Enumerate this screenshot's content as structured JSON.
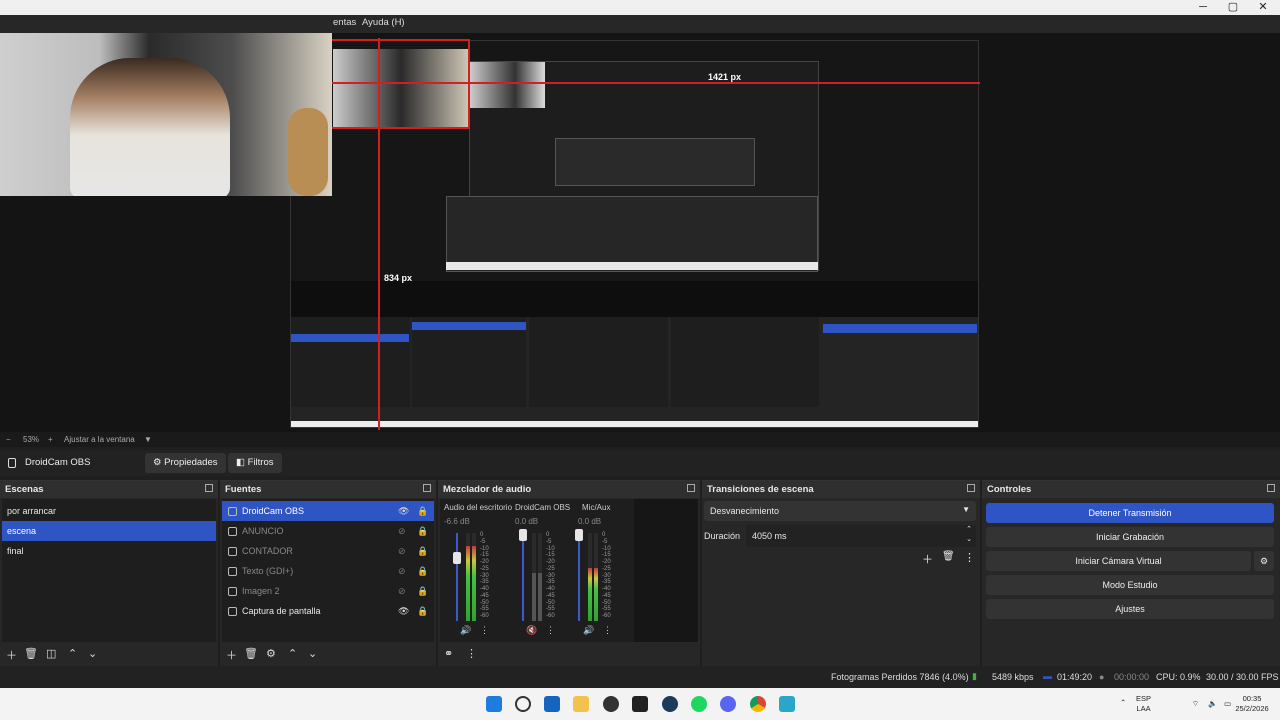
{
  "menu": {
    "item_partial": "entas",
    "help": "Ayuda (H)"
  },
  "window_controls": {
    "minimize": "─",
    "maximize": "▢",
    "close": "✕"
  },
  "measures": {
    "width_px": "1421 px",
    "height_px": "834 px"
  },
  "zoom": {
    "minus": "−",
    "percent": "53%",
    "plus": "+",
    "fit": "Ajustar a la ventana",
    "arrow": "▼"
  },
  "source_bar": {
    "name": "DroidCam OBS",
    "properties": "Propiedades",
    "filters": "Filtros"
  },
  "scenes": {
    "title": "Escenas",
    "items": [
      {
        "label": "por arrancar"
      },
      {
        "label": "escena"
      },
      {
        "label": "final"
      }
    ]
  },
  "sources": {
    "title": "Fuentes",
    "items": [
      {
        "label": "DroidCam OBS"
      },
      {
        "label": "ANUNCIO"
      },
      {
        "label": "CONTADOR"
      },
      {
        "label": "Texto (GDI+)"
      },
      {
        "label": "Imagen 2"
      },
      {
        "label": "Captura de pantalla"
      }
    ]
  },
  "mixer": {
    "title": "Mezclador de audio",
    "channels": [
      {
        "name": "Audio del escritorio",
        "db": "-6.6 dB",
        "level": 0.85,
        "fader": 0.72
      },
      {
        "name": "DroidCam OBS",
        "db": "0.0 dB",
        "level": 0.0,
        "fader": 0.98
      },
      {
        "name": "Mic/Aux",
        "db": "0.0 dB",
        "level": 0.6,
        "fader": 0.98
      }
    ],
    "scale": [
      "0",
      "-5",
      "-10",
      "-15",
      "-20",
      "-25",
      "-30",
      "-35",
      "-40",
      "-45",
      "-50",
      "-55",
      "-60"
    ]
  },
  "transitions": {
    "title": "Transiciones de escena",
    "selected": "Desvanecimiento",
    "duration_label": "Duración",
    "duration_value": "4050 ms"
  },
  "controls": {
    "title": "Controles",
    "buttons": [
      {
        "label": "Detener Transmisión"
      },
      {
        "label": "Iniciar Grabación"
      },
      {
        "label": "Iniciar Cámara Virtual"
      },
      {
        "label": "Modo Estudio"
      },
      {
        "label": "Ajustes"
      }
    ]
  },
  "status": {
    "dropped": "Fotogramas Perdidos 7846 (4.0%)",
    "bitrate": "5489 kbps",
    "stream_time": "01:49:20",
    "rec_time": "00:00:00",
    "cpu": "CPU: 0.9%",
    "fps": "30.00 / 30.00 FPS"
  },
  "taskbar": {
    "lang1": "ESP",
    "lang2": "LAA",
    "time": "00:35",
    "date": "25/2/2026"
  },
  "colors": {
    "accent": "#2f55c4",
    "background": "#1f1f1f",
    "panel": "#272727",
    "measure_red": "#d31f1f"
  }
}
